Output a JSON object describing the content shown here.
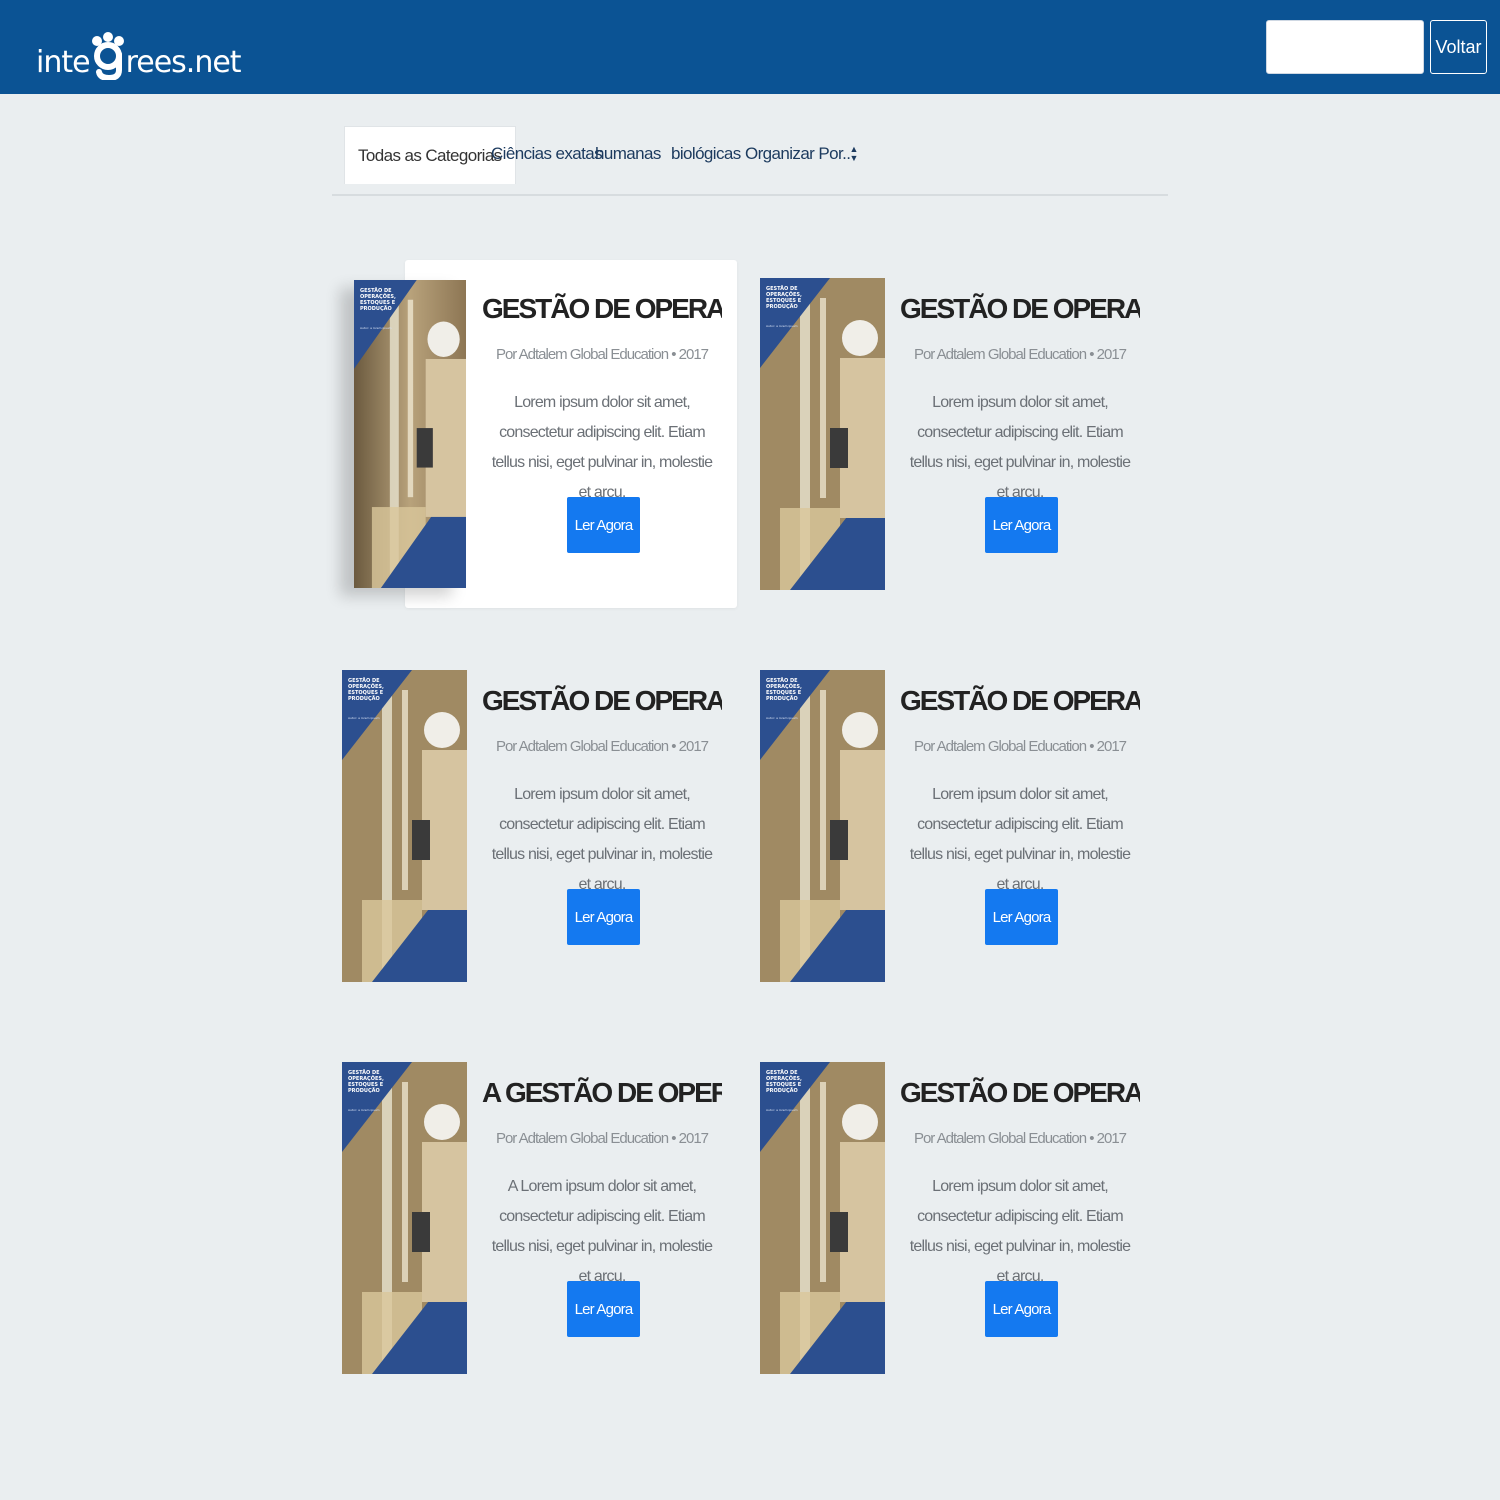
{
  "header": {
    "logo_left": "inte",
    "logo_right": "rees.net",
    "search_placeholder": "",
    "back_label": "Voltar"
  },
  "tabs": [
    {
      "label": "Todas as Categorias",
      "active": true
    },
    {
      "label": "Ciências exatas"
    },
    {
      "label": "humanas"
    },
    {
      "label": "biológicas"
    },
    {
      "label": "Organizar Por.."
    }
  ],
  "sort_icon": "sort-arrows-icon",
  "cover": {
    "title": "GESTÃO DE OPERAÇÕES, ESTOQUES E PRODUÇÃO",
    "subtitle": "Autor: a lorem ipsum"
  },
  "books": [
    {
      "title": "GESTÃO DE OPERAÇÕE...",
      "meta": "Por Adtalem Global Education • 2017",
      "description": "Lorem ipsum dolor sit amet, consectetur adipiscing elit. Etiam tellus nisi, eget pulvinar in, molestie et arcu.",
      "button": "Ler Agora",
      "highlighted": true
    },
    {
      "title": "GESTÃO DE OPERAÇÕE...",
      "meta": "Por Adtalem Global Education • 2017",
      "description": "Lorem ipsum dolor sit amet, consectetur adipiscing elit. Etiam tellus nisi, eget pulvinar in, molestie et arcu.",
      "button": "Ler Agora"
    },
    {
      "title": "GESTÃO DE OPERAÇÕE...",
      "meta": "Por Adtalem Global Education • 2017",
      "description": "Lorem ipsum dolor sit amet, consectetur adipiscing elit. Etiam tellus nisi, eget pulvinar in, molestie et arcu.",
      "button": "Ler Agora"
    },
    {
      "title": "GESTÃO DE OPERAÇÕE...",
      "meta": "Por Adtalem Global Education • 2017",
      "description": "Lorem ipsum dolor sit amet, consectetur adipiscing elit. Etiam tellus nisi, eget pulvinar in, molestie et arcu.",
      "button": "Ler Agora"
    },
    {
      "title": "A GESTÃO DE OPERAÇÕ...",
      "meta": "Por Adtalem Global Education • 2017",
      "description": "A Lorem ipsum dolor sit amet, consectetur adipiscing elit. Etiam tellus nisi, eget pulvinar in, molestie et arcu.",
      "button": "Ler Agora"
    },
    {
      "title": "GESTÃO DE OPERAÇÕE...",
      "meta": "Por Adtalem Global Education • 2017",
      "description": "Lorem ipsum dolor sit amet, consectetur adipiscing elit. Etiam tellus nisi, eget pulvinar in, molestie et arcu.",
      "button": "Ler Agora"
    }
  ],
  "colors": {
    "header": "#0b5394",
    "page_bg": "#eaeef0",
    "button": "#1479f0",
    "cover_blue": "#2c4f8f"
  }
}
